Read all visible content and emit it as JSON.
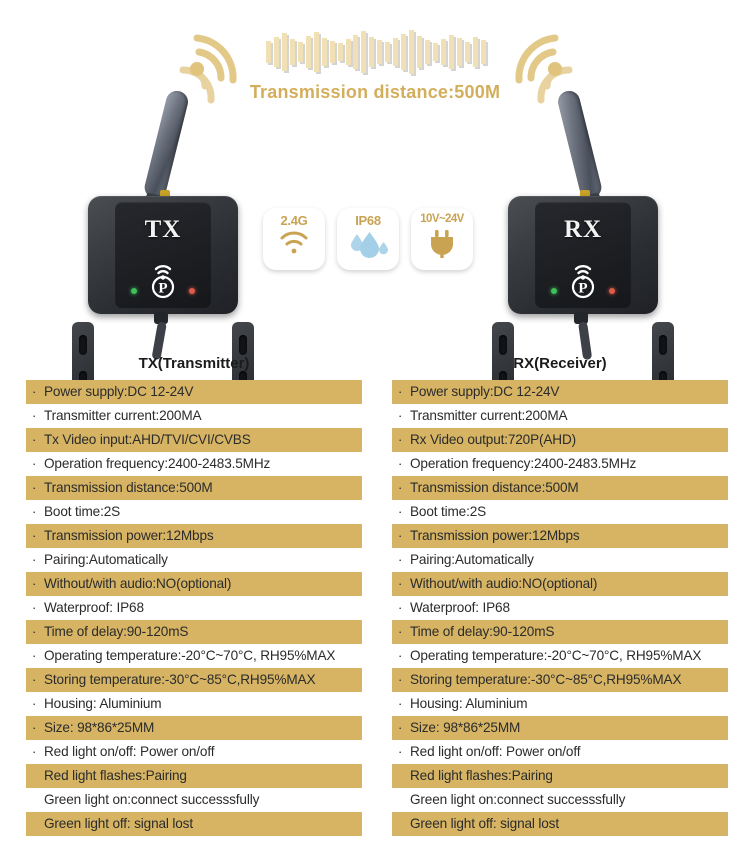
{
  "hero": {
    "transmission_label": "Transmission distance:500M",
    "wave_bar_heights": [
      22,
      30,
      38,
      26,
      20,
      32,
      40,
      28,
      22,
      18,
      26,
      34,
      42,
      30,
      24,
      20,
      28,
      36,
      44,
      32,
      24,
      18,
      26,
      34,
      28,
      20,
      30,
      24
    ],
    "wifi_icon_left": "wifi-signal-icon",
    "wifi_icon_right": "wifi-signal-icon"
  },
  "devices": [
    {
      "id": "tx",
      "name": "TX",
      "led_green": "green-led",
      "led_red": "red-led",
      "pair_icon": "pairing-p-icon"
    },
    {
      "id": "rx",
      "name": "RX",
      "led_green": "green-led",
      "led_red": "red-led",
      "pair_icon": "pairing-p-icon"
    }
  ],
  "badges": [
    {
      "label": "2.4G",
      "icon": "wifi-icon"
    },
    {
      "label": "IP68",
      "icon": "water-drop-icon"
    },
    {
      "label": "10V~24V",
      "icon": "power-plug-icon"
    }
  ],
  "colors": {
    "gold_row": "#D6B463",
    "gold_text": "#D3AE5C",
    "badge_text": "#C9A352",
    "droplet": "#AED4EA",
    "led_green": "#3FBF58",
    "led_red": "#E05A4A"
  },
  "spec_columns": [
    {
      "title": "TX(Transmitter)",
      "rows": [
        {
          "text": "Power supply:DC 12-24V",
          "bullet": true,
          "highlight": true
        },
        {
          "text": "Transmitter current:200MA",
          "bullet": true,
          "highlight": false
        },
        {
          "text": "Tx Video input:AHD/TVI/CVI/CVBS",
          "bullet": true,
          "highlight": true
        },
        {
          "text": "Operation frequency:2400-2483.5MHz",
          "bullet": true,
          "highlight": false
        },
        {
          "text": "Transmission distance:500M",
          "bullet": true,
          "highlight": true
        },
        {
          "text": "Boot time:2S",
          "bullet": true,
          "highlight": false
        },
        {
          "text": "Transmission power:12Mbps",
          "bullet": true,
          "highlight": true
        },
        {
          "text": "Pairing:Automatically",
          "bullet": true,
          "highlight": false
        },
        {
          "text": "Without/with audio:NO(optional)",
          "bullet": true,
          "highlight": true
        },
        {
          "text": "Waterproof: IP68",
          "bullet": true,
          "highlight": false
        },
        {
          "text": "Time of delay:90-120mS",
          "bullet": true,
          "highlight": true
        },
        {
          "text": "Operating temperature:-20°C~70°C, RH95%MAX",
          "bullet": true,
          "highlight": false
        },
        {
          "text": "Storing temperature:-30°C~85°C,RH95%MAX",
          "bullet": true,
          "highlight": true
        },
        {
          "text": "Housing: Aluminium",
          "bullet": true,
          "highlight": false
        },
        {
          "text": "Size: 98*86*25MM",
          "bullet": true,
          "highlight": true
        },
        {
          "text": "Red light on/off: Power on/off",
          "bullet": true,
          "highlight": false
        },
        {
          "text": "Red light flashes:Pairing",
          "bullet": false,
          "highlight": true
        },
        {
          "text": "Green light on:connect successsfully",
          "bullet": false,
          "highlight": false
        },
        {
          "text": "Green light off: signal lost",
          "bullet": false,
          "highlight": true
        }
      ]
    },
    {
      "title": "RX(Receiver)",
      "rows": [
        {
          "text": "Power supply:DC 12-24V",
          "bullet": true,
          "highlight": true
        },
        {
          "text": "Transmitter current:200MA",
          "bullet": true,
          "highlight": false
        },
        {
          "text": "Rx Video output:720P(AHD)",
          "bullet": true,
          "highlight": true
        },
        {
          "text": "Operation frequency:2400-2483.5MHz",
          "bullet": true,
          "highlight": false
        },
        {
          "text": "Transmission distance:500M",
          "bullet": true,
          "highlight": true
        },
        {
          "text": "Boot time:2S",
          "bullet": true,
          "highlight": false
        },
        {
          "text": "Transmission power:12Mbps",
          "bullet": true,
          "highlight": true
        },
        {
          "text": "Pairing:Automatically",
          "bullet": true,
          "highlight": false
        },
        {
          "text": "Without/with audio:NO(optional)",
          "bullet": true,
          "highlight": true
        },
        {
          "text": "Waterproof: IP68",
          "bullet": true,
          "highlight": false
        },
        {
          "text": "Time of delay:90-120mS",
          "bullet": true,
          "highlight": true
        },
        {
          "text": "Operating temperature:-20°C~70°C, RH95%MAX",
          "bullet": true,
          "highlight": false
        },
        {
          "text": "Storing temperature:-30°C~85°C,RH95%MAX",
          "bullet": true,
          "highlight": true
        },
        {
          "text": "Housing: Aluminium",
          "bullet": true,
          "highlight": false
        },
        {
          "text": "Size: 98*86*25MM",
          "bullet": true,
          "highlight": true
        },
        {
          "text": "Red light on/off: Power on/off",
          "bullet": true,
          "highlight": false
        },
        {
          "text": "Red light flashes:Pairing",
          "bullet": false,
          "highlight": true
        },
        {
          "text": "Green light on:connect successsfully",
          "bullet": false,
          "highlight": false
        },
        {
          "text": "Green light off: signal lost",
          "bullet": false,
          "highlight": true
        }
      ]
    }
  ]
}
